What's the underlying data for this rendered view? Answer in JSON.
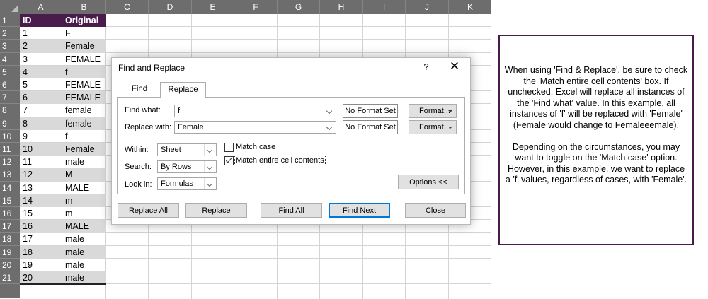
{
  "sheet": {
    "columns": [
      "A",
      "B",
      "C",
      "D",
      "E",
      "F",
      "G",
      "H",
      "I",
      "J",
      "K"
    ],
    "rows": [
      {
        "n": "1",
        "a": "ID",
        "b": "Original"
      },
      {
        "n": "2",
        "a": "1",
        "b": "F"
      },
      {
        "n": "3",
        "a": "2",
        "b": "Female"
      },
      {
        "n": "4",
        "a": "3",
        "b": "FEMALE"
      },
      {
        "n": "5",
        "a": "4",
        "b": "f"
      },
      {
        "n": "6",
        "a": "5",
        "b": "FEMALE"
      },
      {
        "n": "7",
        "a": "6",
        "b": "FEMALE"
      },
      {
        "n": "8",
        "a": "7",
        "b": "female"
      },
      {
        "n": "9",
        "a": "8",
        "b": "female"
      },
      {
        "n": "10",
        "a": "9",
        "b": "f"
      },
      {
        "n": "11",
        "a": "10",
        "b": "Female"
      },
      {
        "n": "12",
        "a": "11",
        "b": "male"
      },
      {
        "n": "13",
        "a": "12",
        "b": "M"
      },
      {
        "n": "14",
        "a": "13",
        "b": "MALE"
      },
      {
        "n": "15",
        "a": "14",
        "b": "m"
      },
      {
        "n": "16",
        "a": "15",
        "b": "m"
      },
      {
        "n": "17",
        "a": "16",
        "b": "MALE"
      },
      {
        "n": "18",
        "a": "17",
        "b": "male"
      },
      {
        "n": "19",
        "a": "18",
        "b": "male"
      },
      {
        "n": "20",
        "a": "19",
        "b": "male"
      },
      {
        "n": "21",
        "a": "20",
        "b": "male"
      }
    ]
  },
  "dialog": {
    "title": "Find and Replace",
    "help": "?",
    "close": "✕",
    "tabs": {
      "find": "Find",
      "replace": "Replace"
    },
    "find_what_label": "Find what:",
    "find_what_value": "f",
    "replace_with_label": "Replace with:",
    "replace_with_value": "Female",
    "no_format_set": "No Format Set",
    "format_button": "Format...",
    "within_label": "Within:",
    "within_value": "Sheet",
    "search_label": "Search:",
    "search_value": "By Rows",
    "lookin_label": "Look in:",
    "lookin_value": "Formulas",
    "match_case_label": "Match case",
    "match_case_checked": false,
    "match_entire_label": "Match entire cell contents",
    "match_entire_checked": true,
    "options_button": "Options <<",
    "buttons": {
      "replace_all": "Replace All",
      "replace": "Replace",
      "find_all": "Find All",
      "find_next": "Find Next",
      "close": "Close"
    }
  },
  "note": {
    "paragraph1": "When using 'Find & Replace', be sure to check the 'Match entire cell contents' box. If unchecked, Excel will replace all instances of the 'Find what' value. In this example, all instances of 'f' will be replaced with 'Female' (Female would change to Femaleeemale).",
    "paragraph2": "Depending on the circumstances, you may want to toggle on the 'Match case' option. However, in this example, we want to replace a 'f' values, regardless of cases, with 'Female'.",
    "border_color": "#4a1c4c"
  },
  "colors": {
    "header_fill": "#4a1c4c",
    "shade_fill": "#d9d9d9",
    "headings_fill": "#6d6d6d",
    "accent": "#0078d7"
  }
}
